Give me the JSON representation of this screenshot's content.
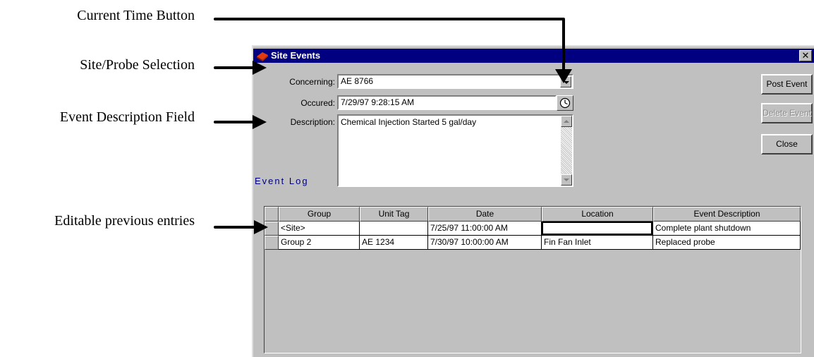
{
  "callouts": {
    "current_time": "Current Time Button",
    "site_probe": "Site/Probe Selection",
    "event_description": "Event Description Field",
    "editable_entries": "Editable previous entries"
  },
  "window": {
    "title": "Site Events",
    "title_icon": "app-book-icon",
    "close_glyph": "✕",
    "titlebar_color": "#000080",
    "face_color": "#c0c0c0"
  },
  "form": {
    "concerning_label": "Concerning:",
    "concerning_value": "AE 8766",
    "occured_label": "Occured:",
    "occured_value": "7/29/97 9:28:15 AM",
    "description_label": "Description:",
    "description_value": "Chemical Injection Started 5 gal/day",
    "clock_icon": "clock-icon"
  },
  "buttons": {
    "post_event": "Post Event",
    "delete_event": "Delete Event",
    "close": "Close"
  },
  "event_log": {
    "caption": "Event Log",
    "columns": [
      "Group",
      "Unit Tag",
      "Date",
      "Location",
      "Event Description"
    ],
    "rows": [
      {
        "group": "<Site>",
        "unit_tag": "",
        "date": "7/25/97 11:00:00 AM",
        "location": "",
        "event_description": "Complete plant shutdown"
      },
      {
        "group": "Group 2",
        "unit_tag": "AE 1234",
        "date": "7/30/97 10:00:00 AM",
        "location": "Fin Fan Inlet",
        "event_description": "Replaced probe"
      }
    ]
  }
}
